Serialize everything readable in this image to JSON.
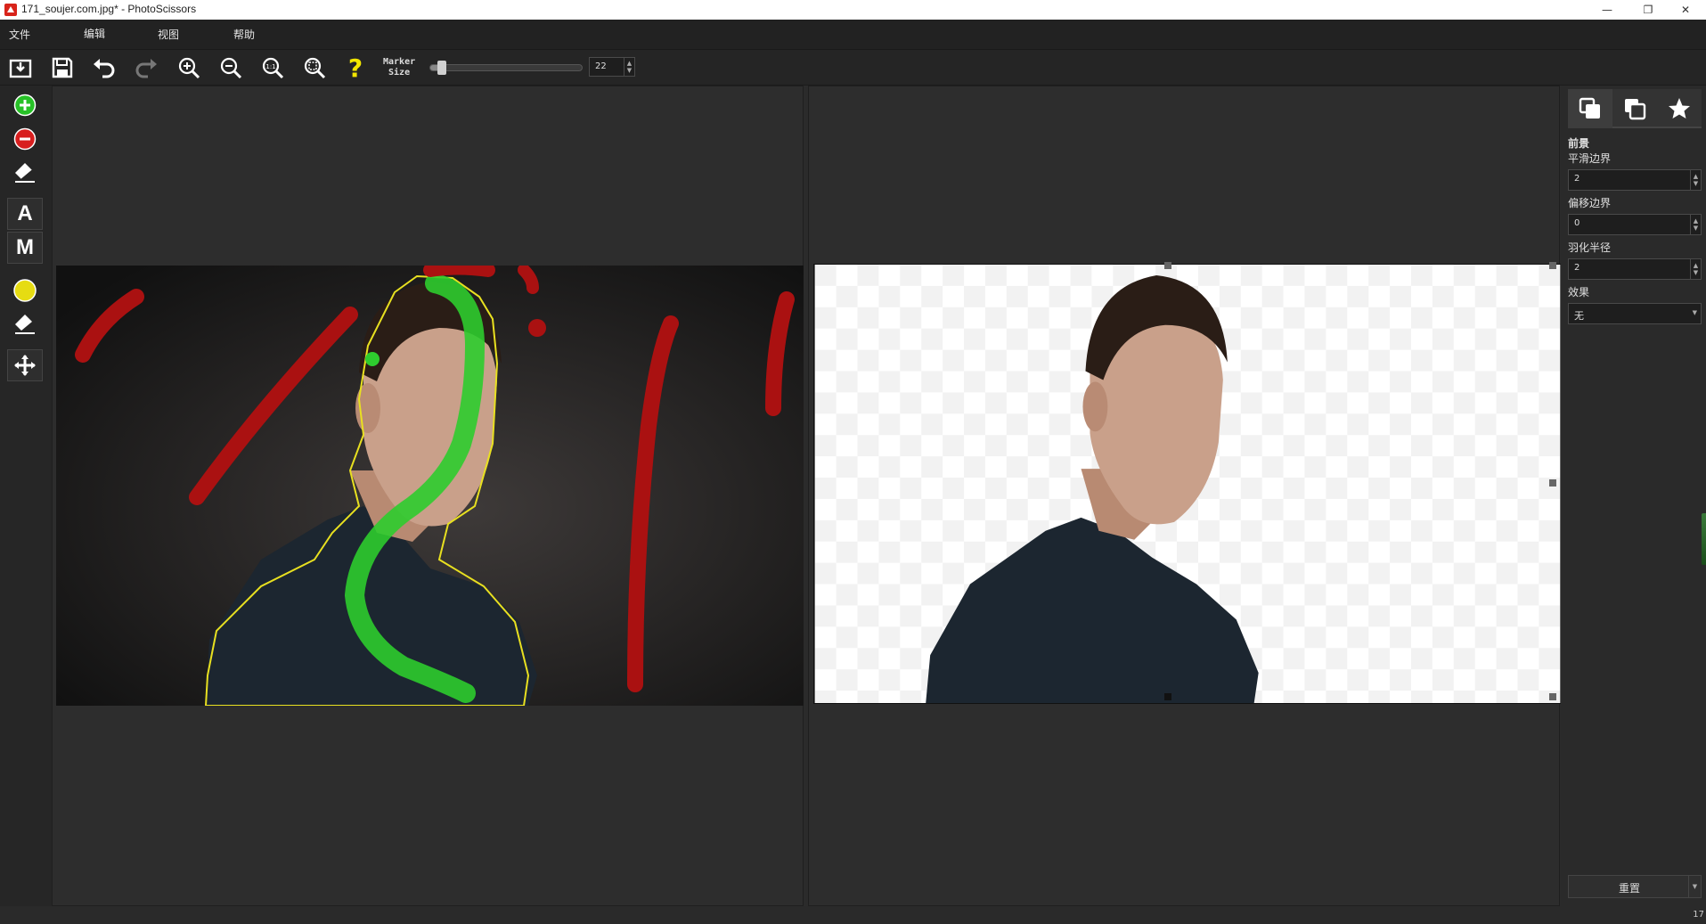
{
  "window": {
    "title": "171_soujer.com.jpg* - PhotoScissors",
    "minimize_symbol": "—",
    "restore_symbol": "❐",
    "close_symbol": "✕"
  },
  "menu": {
    "items": [
      {
        "label": "文件"
      },
      {
        "label": "编辑"
      },
      {
        "label": "视图"
      },
      {
        "label": "帮助"
      }
    ]
  },
  "toolbar": {
    "icons": [
      "open-icon",
      "save-icon",
      "undo-icon",
      "redo-icon",
      "zoom-in-icon",
      "zoom-out-icon",
      "zoom-actual-icon",
      "zoom-fit-icon",
      "help-icon"
    ],
    "marker_label_line1": "Marker",
    "marker_label_line2": "Size",
    "marker_size_value": "22",
    "marker_size_fraction": 0.05
  },
  "left_tools": {
    "icons": [
      "add-foreground-icon",
      "add-background-icon",
      "eraser-icon",
      "auto-mode-icon",
      "manual-mode-icon",
      "color-marker-icon",
      "color-eraser-icon",
      "move-icon"
    ],
    "auto_label": "A",
    "manual_label": "M"
  },
  "right_panel": {
    "tabs": [
      "foreground-tab-icon",
      "background-tab-icon",
      "effects-tab-icon"
    ],
    "section_title": "前景",
    "smooth_label": "平滑边界",
    "smooth_value": "2",
    "offset_label": "偏移边界",
    "offset_value": "0",
    "feather_label": "羽化半径",
    "feather_value": "2",
    "effect_label": "效果",
    "effect_value": "无",
    "reset_label": "重置"
  },
  "status": {
    "text": "17"
  },
  "colors": {
    "foreground_marker": "#2ecc2e",
    "background_marker": "#aa1111",
    "selection_outline": "#e8e020",
    "help_icon": "#f2e600"
  }
}
